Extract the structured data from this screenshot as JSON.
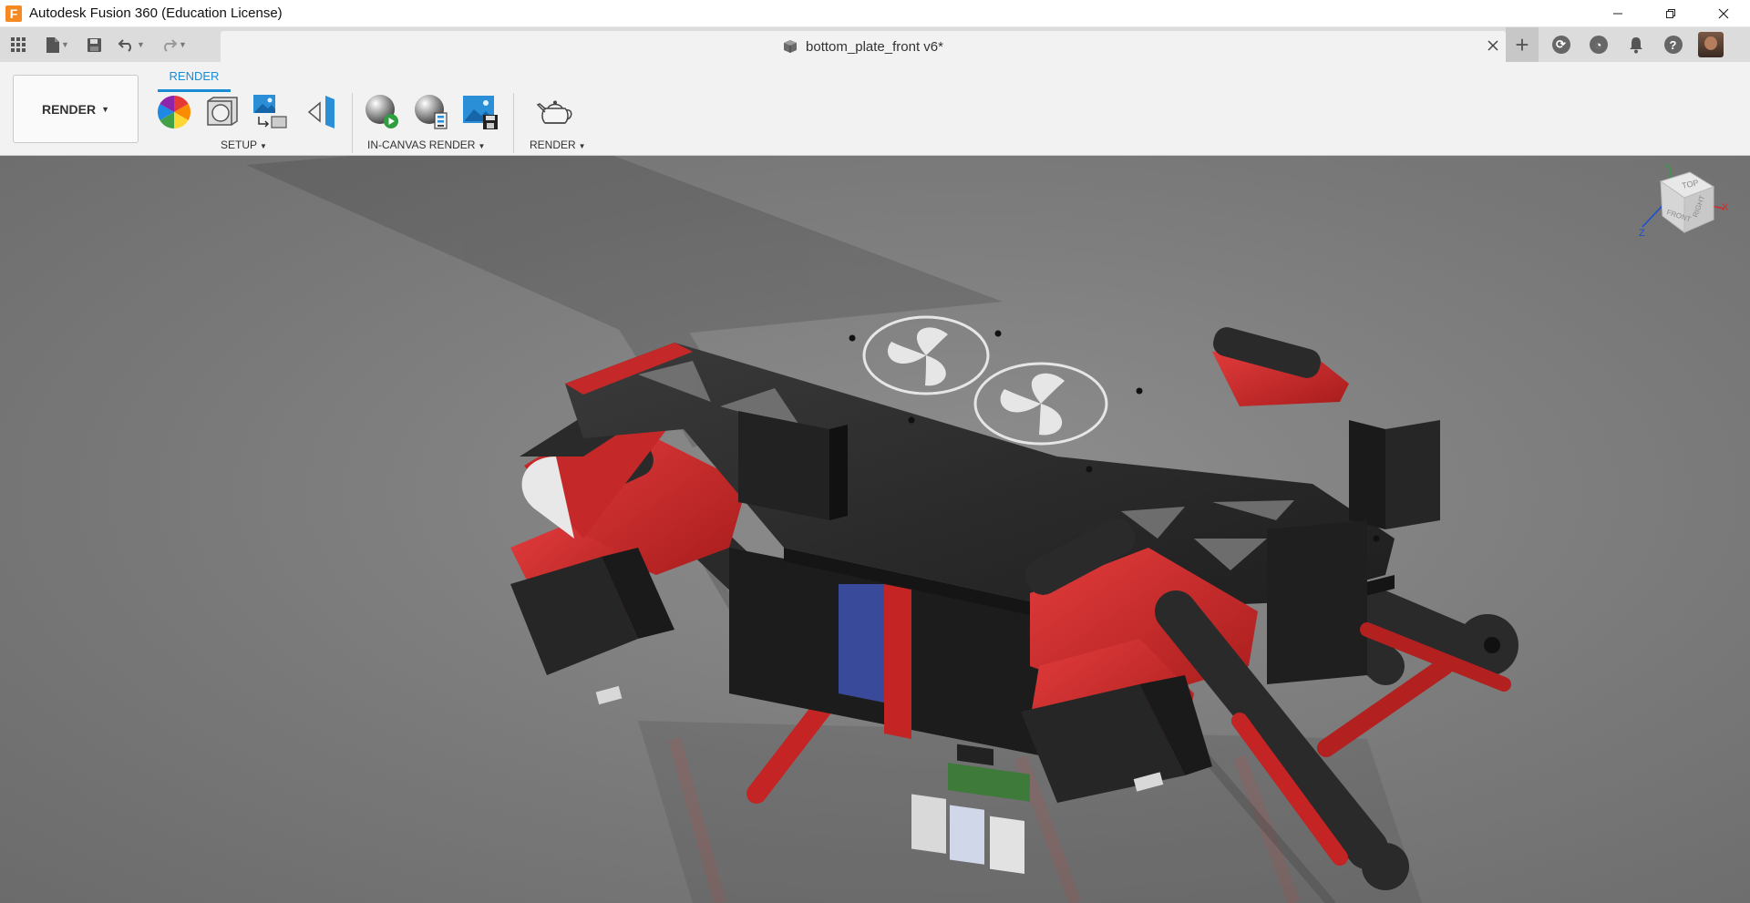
{
  "window": {
    "title": "Autodesk Fusion 360 (Education License)",
    "logo_letter": "F"
  },
  "document": {
    "name": "bottom_plate_front v6*"
  },
  "ribbon": {
    "workspace_label": "RENDER",
    "active_tab": "RENDER",
    "groups": {
      "setup": "SETUP",
      "in_canvas": "IN-CANVAS RENDER",
      "render": "RENDER"
    }
  },
  "viewcube": {
    "top": "TOP",
    "front": "FRONT",
    "right": "RIGHT",
    "axis_x": "X",
    "axis_y": "Y",
    "axis_z": "Z"
  },
  "colors": {
    "accent": "#1a8bd5",
    "logo": "#f58a23",
    "model_red": "#d42a2a",
    "model_black": "#2a2a2a"
  },
  "icons": [
    "apps-grid-icon",
    "file-icon",
    "save-icon",
    "undo-icon",
    "redo-icon",
    "close-icon",
    "plus-icon",
    "sync-icon",
    "history-icon",
    "bell-icon",
    "help-icon",
    "minimize-icon",
    "maximize-icon"
  ]
}
